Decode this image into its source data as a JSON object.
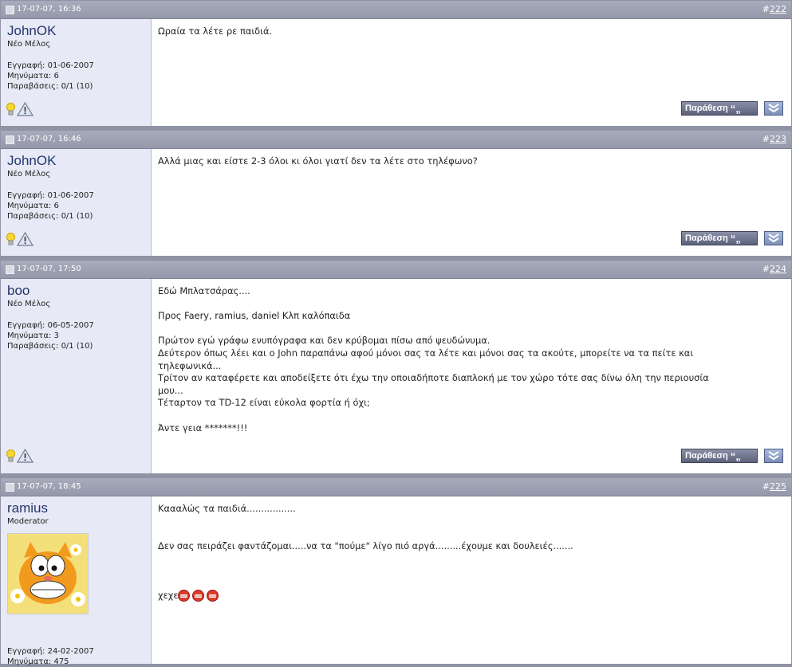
{
  "posts": [
    {
      "date": "17-07-07, 16:36",
      "hash": "#",
      "number": "222",
      "user": {
        "name": "JohnOK",
        "title": "Νέο Μέλος",
        "info": [
          "Εγγραφή: 01-06-2007",
          "Μηνύματα: 6",
          "Παραβάσεις: 0/1 (10)"
        ]
      },
      "message": [
        "Ωραία τα λέτε ρε παιδιά."
      ]
    },
    {
      "date": "17-07-07, 16:46",
      "hash": "#",
      "number": "223",
      "user": {
        "name": "JohnOK",
        "title": "Νέο Μέλος",
        "info": [
          "Εγγραφή: 01-06-2007",
          "Μηνύματα: 6",
          "Παραβάσεις: 0/1 (10)"
        ]
      },
      "message": [
        "Αλλά μιας και είστε 2-3 όλοι κι όλοι γιατί δεν τα λέτε στο τηλέφωνο?"
      ]
    },
    {
      "date": "17-07-07, 17:50",
      "hash": "#",
      "number": "224",
      "user": {
        "name": "boo",
        "title": "Νέο Μέλος",
        "info": [
          "Εγγραφή: 06-05-2007",
          "Μηνύματα: 3",
          "Παραβάσεις: 0/1 (10)"
        ]
      },
      "message": [
        "Εδώ Μπλατσάρας....",
        "",
        "Προς Faery, ramius, daniel Κλπ καλόπαιδα",
        "",
        "Πρώτον εγώ γράφω ενυπόγραφα και δεν κρύβομαι πίσω από ψευδώνυμα.",
        "Δεύτερον όπως λέει και ο John παραπάνω αφού μόνοι σας τα λέτε και μόνοι σας τα ακούτε, μπορείτε να τα πείτε και",
        "τηλεφωνικά...",
        "Τρίτον αν καταφέρετε και αποδείξετε ότι έχω την οποιαδήποτε διαπλοκή με τον χώρο τότε σας δίνω όλη την περιουσία",
        "μου...",
        "Τέταρτον τα TD-12 είναι εύκολα φορτία ή όχι;",
        "",
        "Άντε γεια *******!!!"
      ]
    },
    {
      "date": "17-07-07, 18:45",
      "hash": "#",
      "number": "225",
      "user": {
        "name": "ramius",
        "title": "Moderator",
        "info": [
          "Εγγραφή: 24-02-2007",
          "Μηνύματα: 475"
        ]
      },
      "message": [
        "Καααλώς τα παιδιά.................",
        "",
        "",
        "Δεν σας πειράζει φαντάζομαι.....να τα \"πούμε\" λίγο πιό αργά.........έχουμε και δουλειές.......",
        "",
        "",
        "",
        ""
      ],
      "last_line": "χεχε"
    }
  ],
  "buttons": {
    "quote_label": "Παράθεση",
    "quote_mark": "“„"
  },
  "colors": {
    "header": "#9a9eb0",
    "user_column": "#e8e9f6",
    "username": "#22366b"
  }
}
